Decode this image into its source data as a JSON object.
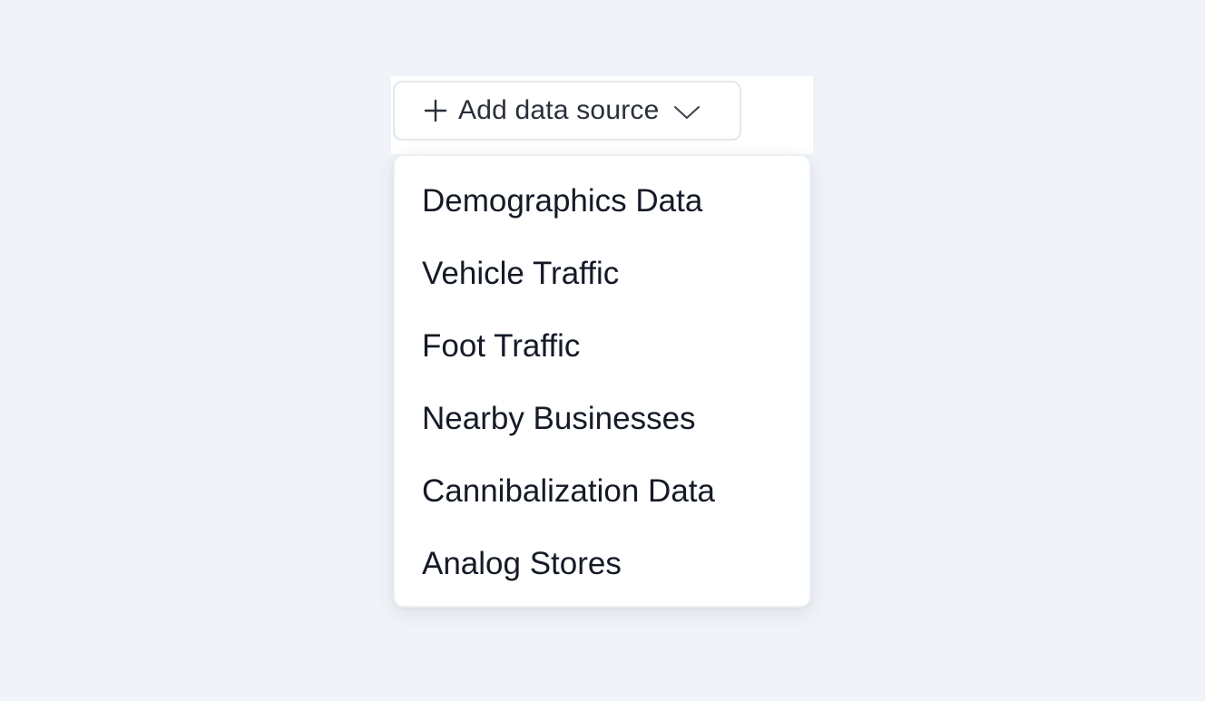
{
  "dropdown": {
    "trigger_label": "Add data source",
    "items": [
      {
        "label": "Demographics Data"
      },
      {
        "label": "Vehicle Traffic"
      },
      {
        "label": "Foot Traffic"
      },
      {
        "label": "Nearby Businesses"
      },
      {
        "label": "Cannibalization Data"
      },
      {
        "label": "Analog Stores"
      }
    ]
  },
  "icons": {
    "plus": "plus-icon",
    "chevron": "chevron-down-icon"
  },
  "colors": {
    "background": "#f0f4f8",
    "surface": "#ffffff",
    "border": "#e3e6eb",
    "text": "#141a26"
  }
}
